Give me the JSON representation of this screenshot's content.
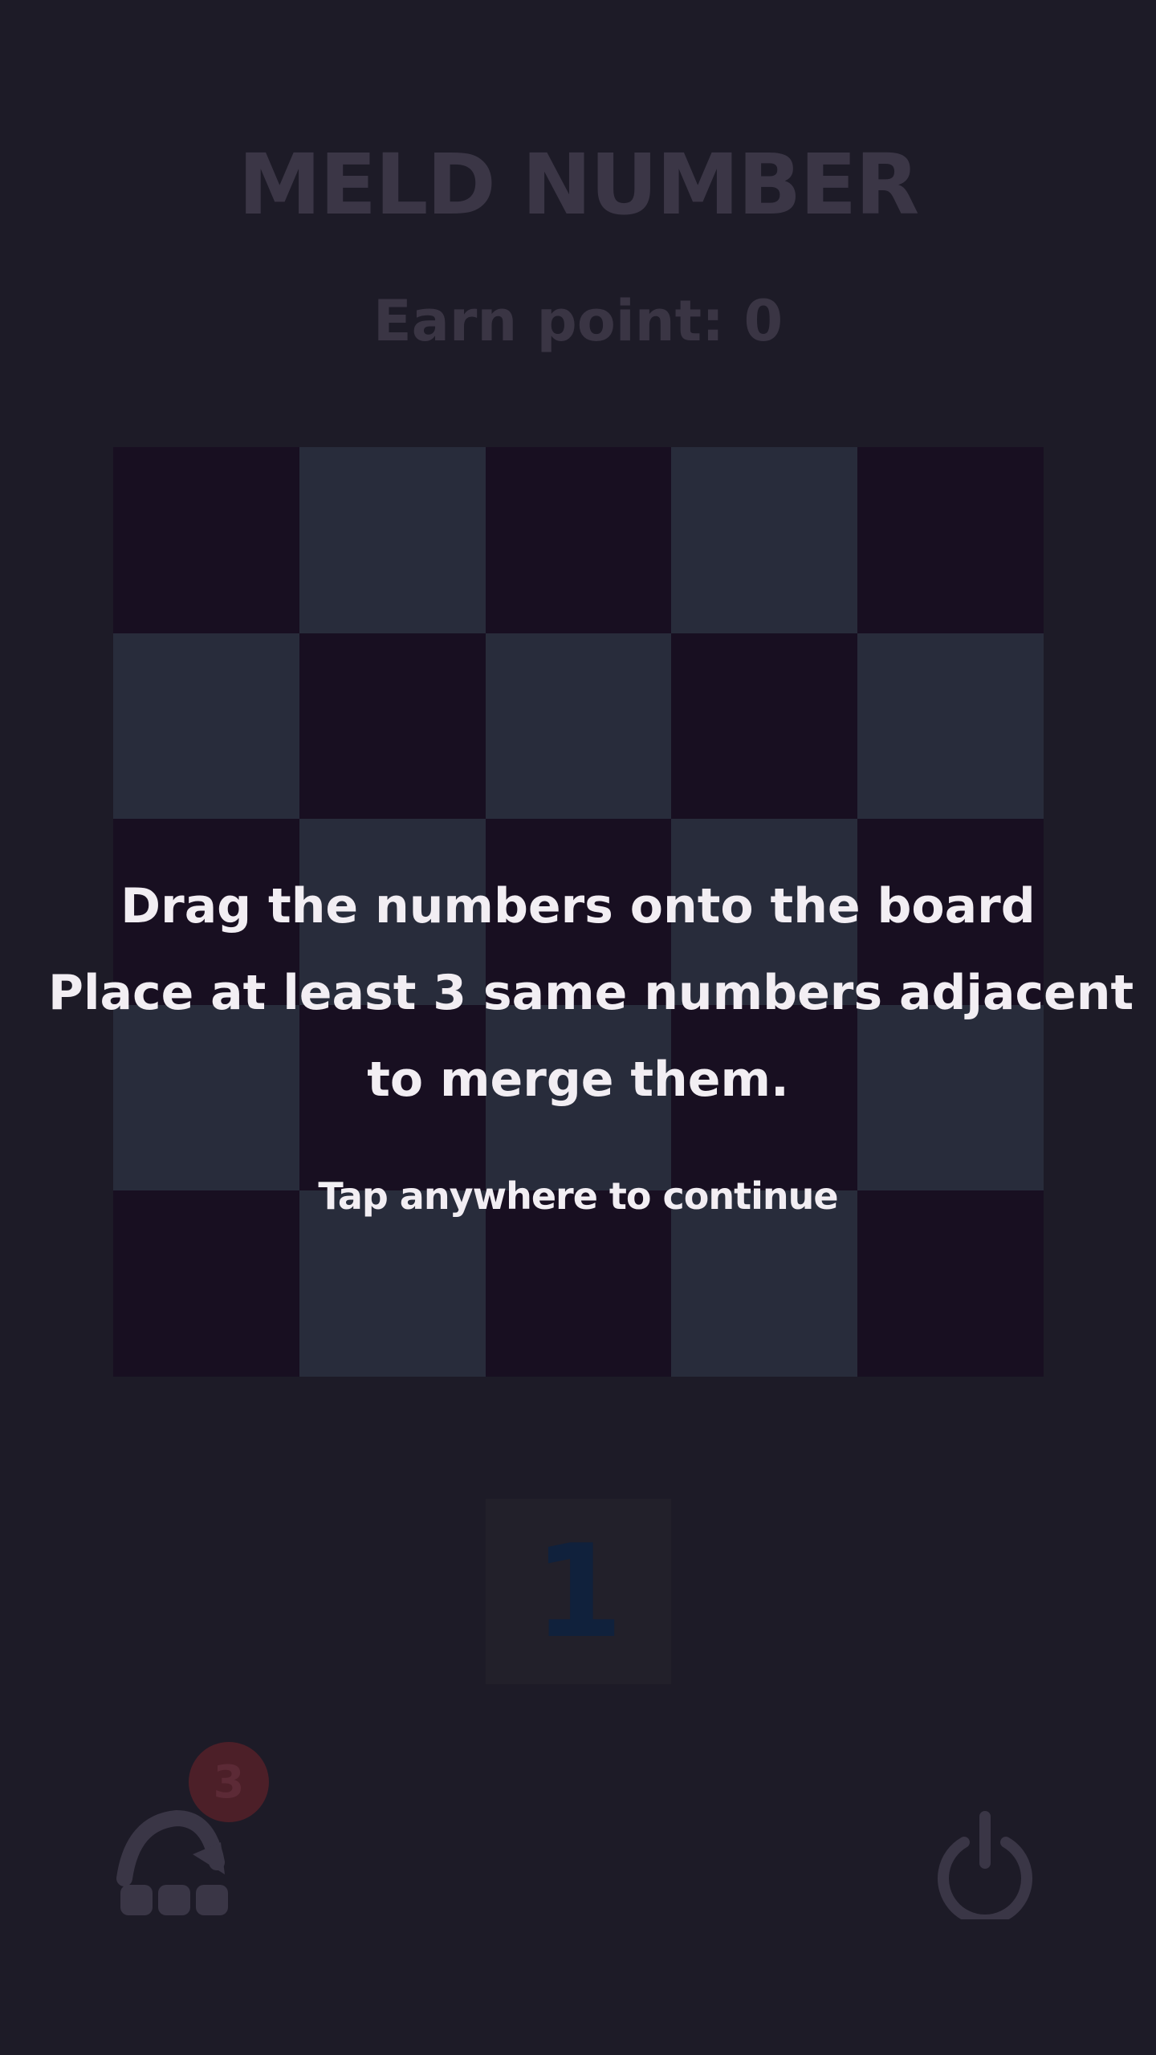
{
  "game": {
    "title": "MELD NUMBER",
    "score_text": "Earn point: 0"
  },
  "board": {
    "rows": 5,
    "cols": 5,
    "pattern": "checkerboard",
    "dark_color": "#180f21",
    "light_color": "#282c3b",
    "cells": [
      [
        null,
        null,
        null,
        null,
        null
      ],
      [
        null,
        null,
        null,
        null,
        null
      ],
      [
        null,
        null,
        null,
        null,
        null
      ],
      [
        null,
        null,
        null,
        null,
        null
      ],
      [
        null,
        null,
        null,
        null,
        null
      ]
    ]
  },
  "tray": {
    "next_number": "1"
  },
  "controls": {
    "undo_icon": "undo-arrow-icon",
    "undo_count": "3",
    "power_icon": "power-icon"
  },
  "tutorial": {
    "lines": [
      "Drag the numbers onto the board",
      "Place at least 3 same numbers adjacent",
      "to merge them."
    ],
    "continue_text": "Tap anywhere to continue"
  },
  "colors": {
    "background": "#1d1b27",
    "title": "#3b3646",
    "overlay_text": "#f2eef3",
    "badge": "#4c1f28"
  }
}
